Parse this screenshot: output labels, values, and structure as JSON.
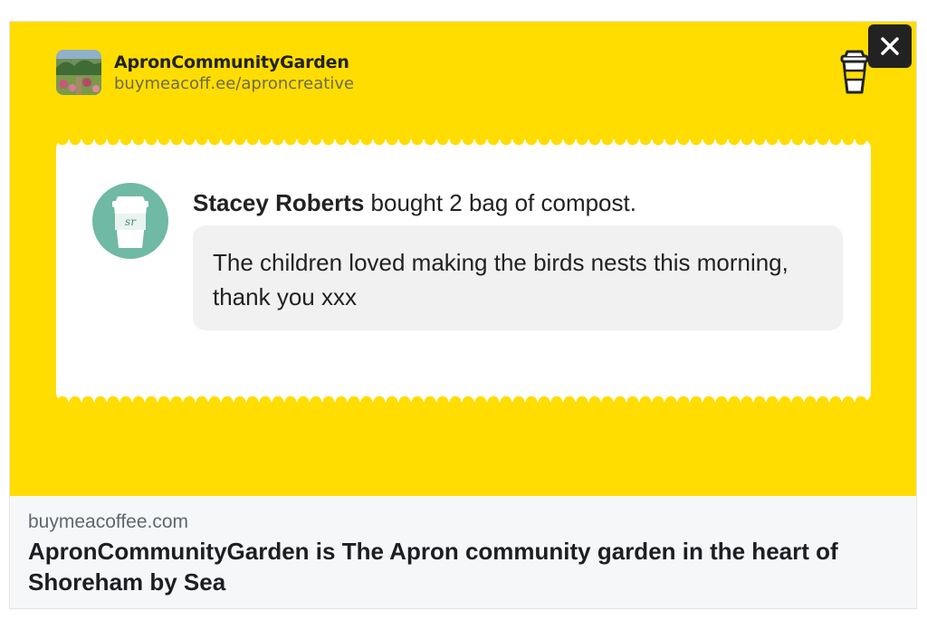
{
  "brand": {
    "name": "ApronCommunityGarden",
    "url": "buymeacoff.ee/aproncreative",
    "thumbnail_icon": "garden-photo",
    "cup_icon": "coffee-cup-icon"
  },
  "close_button": {
    "icon": "close-icon"
  },
  "message": {
    "supporter_name": "Stacey Roberts",
    "action_text": " bought 2 bag of compost.",
    "avatar_initials": "sr",
    "body": "The children loved making the birds nests this morning, thank you xxx"
  },
  "link_preview": {
    "domain": "buymeacoffee.com",
    "title": "ApronCommunityGarden is The Apron community garden in the heart of Shoreham by Sea"
  },
  "colors": {
    "hero_background": "#ffdd00",
    "avatar_background": "#6fb9a5",
    "bubble_background": "#f1f1f1",
    "close_button_background": "#222222"
  }
}
